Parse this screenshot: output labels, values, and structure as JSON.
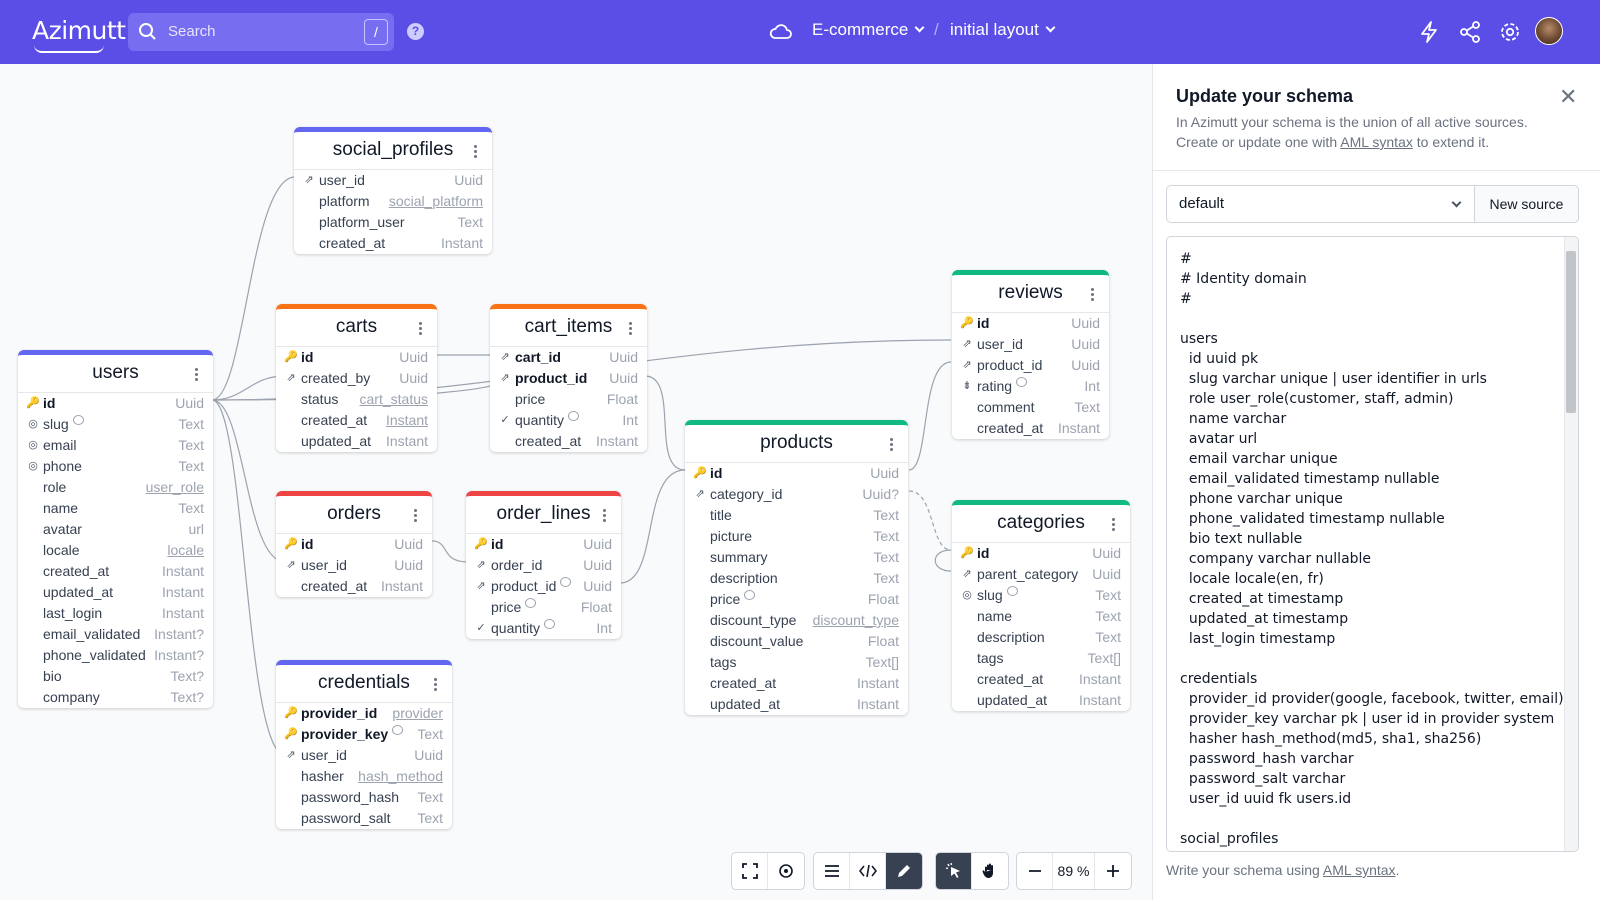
{
  "nav": {
    "logo": "Azimutt",
    "search_placeholder": "Search",
    "search_shortcut": "/",
    "project": "E-commerce",
    "separator": "/",
    "layout": "initial layout",
    "icons": [
      "help-icon",
      "cloud-icon",
      "lightning-icon",
      "share-icon",
      "gear-icon",
      "avatar"
    ]
  },
  "tables": {
    "social_profiles": {
      "name": "social_profiles",
      "color": "#6366f1",
      "columns": [
        {
          "icon": "fk",
          "name": "user_id",
          "type": "Uuid"
        },
        {
          "name": "platform",
          "type": "social_platform",
          "type_link": true
        },
        {
          "name": "platform_user",
          "type": "Text"
        },
        {
          "name": "created_at",
          "type": "Instant"
        }
      ]
    },
    "carts": {
      "name": "carts",
      "color": "#f97316",
      "columns": [
        {
          "icon": "pk",
          "name": "id",
          "type": "Uuid",
          "pk": true
        },
        {
          "icon": "fk",
          "name": "created_by",
          "type": "Uuid"
        },
        {
          "name": "status",
          "type": "cart_status",
          "type_link": true
        },
        {
          "name": "created_at",
          "type": "Instant",
          "type_link": true
        },
        {
          "name": "updated_at",
          "type": "Instant"
        }
      ]
    },
    "cart_items": {
      "name": "cart_items",
      "color": "#f97316",
      "columns": [
        {
          "icon": "fk",
          "name": "cart_id",
          "type": "Uuid",
          "pk": true
        },
        {
          "icon": "fk",
          "name": "product_id",
          "type": "Uuid",
          "pk": true
        },
        {
          "name": "price",
          "type": "Float"
        },
        {
          "icon": "check",
          "name": "quantity",
          "type": "Int",
          "comment": true
        },
        {
          "name": "created_at",
          "type": "Instant"
        }
      ]
    },
    "users": {
      "name": "users",
      "color": "#6366f1",
      "columns": [
        {
          "icon": "pk",
          "name": "id",
          "type": "Uuid",
          "pk": true
        },
        {
          "icon": "uq",
          "name": "slug",
          "type": "Text",
          "comment": true
        },
        {
          "icon": "uq",
          "name": "email",
          "type": "Text"
        },
        {
          "icon": "uq",
          "name": "phone",
          "type": "Text"
        },
        {
          "name": "role",
          "type": "user_role",
          "type_link": true
        },
        {
          "name": "name",
          "type": "Text"
        },
        {
          "name": "avatar",
          "type": "url"
        },
        {
          "name": "locale",
          "type": "locale",
          "type_link": true
        },
        {
          "name": "created_at",
          "type": "Instant"
        },
        {
          "name": "updated_at",
          "type": "Instant"
        },
        {
          "name": "last_login",
          "type": "Instant"
        },
        {
          "name": "email_validated",
          "type": "Instant?"
        },
        {
          "name": "phone_validated",
          "type": "Instant?"
        },
        {
          "name": "bio",
          "type": "Text?"
        },
        {
          "name": "company",
          "type": "Text?"
        }
      ]
    },
    "reviews": {
      "name": "reviews",
      "color": "#10b981",
      "columns": [
        {
          "icon": "pk",
          "name": "id",
          "type": "Uuid",
          "pk": true
        },
        {
          "icon": "fk",
          "name": "user_id",
          "type": "Uuid"
        },
        {
          "icon": "fk",
          "name": "product_id",
          "type": "Uuid"
        },
        {
          "icon": "idx",
          "name": "rating",
          "type": "Int",
          "comment": true
        },
        {
          "name": "comment",
          "type": "Text"
        },
        {
          "name": "created_at",
          "type": "Instant"
        }
      ]
    },
    "orders": {
      "name": "orders",
      "color": "#ef4444",
      "columns": [
        {
          "icon": "pk",
          "name": "id",
          "type": "Uuid",
          "pk": true
        },
        {
          "icon": "fk",
          "name": "user_id",
          "type": "Uuid"
        },
        {
          "name": "created_at",
          "type": "Instant"
        }
      ]
    },
    "order_lines": {
      "name": "order_lines",
      "color": "#ef4444",
      "columns": [
        {
          "icon": "pk",
          "name": "id",
          "type": "Uuid",
          "pk": true
        },
        {
          "icon": "fk",
          "name": "order_id",
          "type": "Uuid"
        },
        {
          "icon": "fk",
          "name": "product_id",
          "type": "Uuid",
          "comment": true
        },
        {
          "name": "price",
          "type": "Float",
          "comment": true
        },
        {
          "icon": "check",
          "name": "quantity",
          "type": "Int",
          "comment": true
        }
      ]
    },
    "products": {
      "name": "products",
      "color": "#10b981",
      "columns": [
        {
          "icon": "pk",
          "name": "id",
          "type": "Uuid",
          "pk": true
        },
        {
          "icon": "fk",
          "name": "category_id",
          "type": "Uuid?"
        },
        {
          "name": "title",
          "type": "Text"
        },
        {
          "name": "picture",
          "type": "Text"
        },
        {
          "name": "summary",
          "type": "Text"
        },
        {
          "name": "description",
          "type": "Text"
        },
        {
          "name": "price",
          "type": "Float",
          "comment": true
        },
        {
          "name": "discount_type",
          "type": "discount_type",
          "type_link": true
        },
        {
          "name": "discount_value",
          "type": "Float"
        },
        {
          "name": "tags",
          "type": "Text[]"
        },
        {
          "name": "created_at",
          "type": "Instant"
        },
        {
          "name": "updated_at",
          "type": "Instant"
        }
      ]
    },
    "categories": {
      "name": "categories",
      "color": "#10b981",
      "columns": [
        {
          "icon": "pk",
          "name": "id",
          "type": "Uuid",
          "pk": true
        },
        {
          "icon": "fk",
          "name": "parent_category",
          "type": "Uuid"
        },
        {
          "icon": "uq",
          "name": "slug",
          "type": "Text",
          "comment": true
        },
        {
          "name": "name",
          "type": "Text"
        },
        {
          "name": "description",
          "type": "Text"
        },
        {
          "name": "tags",
          "type": "Text[]"
        },
        {
          "name": "created_at",
          "type": "Instant"
        },
        {
          "name": "updated_at",
          "type": "Instant"
        }
      ]
    },
    "credentials": {
      "name": "credentials",
      "color": "#6366f1",
      "columns": [
        {
          "icon": "pk",
          "name": "provider_id",
          "type": "provider",
          "pk": true,
          "type_link": true
        },
        {
          "icon": "pk",
          "name": "provider_key",
          "type": "Text",
          "pk": true,
          "comment": true
        },
        {
          "icon": "fk",
          "name": "user_id",
          "type": "Uuid"
        },
        {
          "name": "hasher",
          "type": "hash_method",
          "type_link": true
        },
        {
          "name": "password_hash",
          "type": "Text"
        },
        {
          "name": "password_salt",
          "type": "Text"
        }
      ]
    }
  },
  "toolbar": {
    "zoom": "89 %"
  },
  "panel": {
    "title": "Update your schema",
    "desc_1": "In Azimutt your schema is the union of all active sources.",
    "desc_2a": "Create or update one with ",
    "desc_link": "AML syntax",
    "desc_2b": " to extend it.",
    "source": "default",
    "new_source": "New source",
    "code": "#\n# Identity domain\n#\n\nusers\n  id uuid pk\n  slug varchar unique | user identifier in urls\n  role user_role(customer, staff, admin)\n  name varchar\n  avatar url\n  email varchar unique\n  email_validated timestamp nullable\n  phone varchar unique\n  phone_validated timestamp nullable\n  bio text nullable\n  company varchar nullable\n  locale locale(en, fr)\n  created_at timestamp\n  updated_at timestamp\n  last_login timestamp\n\ncredentials\n  provider_id provider(google, facebook, twitter, email) pk\n  provider_key varchar pk | user id in provider system\n  hasher hash_method(md5, sha1, sha256)\n  password_hash varchar\n  password_salt varchar\n  user_id uuid fk users.id\n\nsocial_profiles\n  user_id uuid fk users.id",
    "footer_a": "Write your schema using ",
    "footer_link": "AML syntax",
    "footer_b": "."
  }
}
